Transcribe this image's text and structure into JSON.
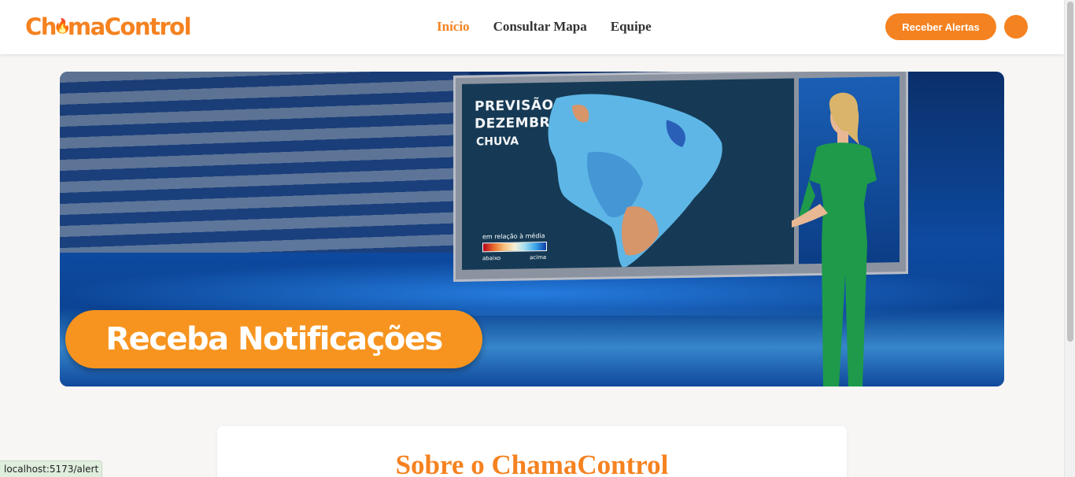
{
  "header": {
    "logo_text_a": "Ch",
    "logo_text_b": "maControl",
    "nav": [
      {
        "label": "Início",
        "active": true
      },
      {
        "label": "Consultar Mapa",
        "active": false
      },
      {
        "label": "Equipe",
        "active": false
      }
    ],
    "alert_button_label": "Receber Alertas"
  },
  "banner": {
    "screen_title_line1": "PREVISÃO",
    "screen_title_line2": "DEZEMBRO",
    "screen_subtitle": "CHUVA",
    "legend_label": "em relação à média",
    "legend_low": "abaixo",
    "legend_high": "acima",
    "cta_label": "Receba Notificações"
  },
  "about": {
    "title": "Sobre o ChamaControl"
  },
  "status_bar": {
    "url": "localhost:5173/alert"
  },
  "colors": {
    "accent": "#f58220",
    "cta": "#f7941f"
  }
}
